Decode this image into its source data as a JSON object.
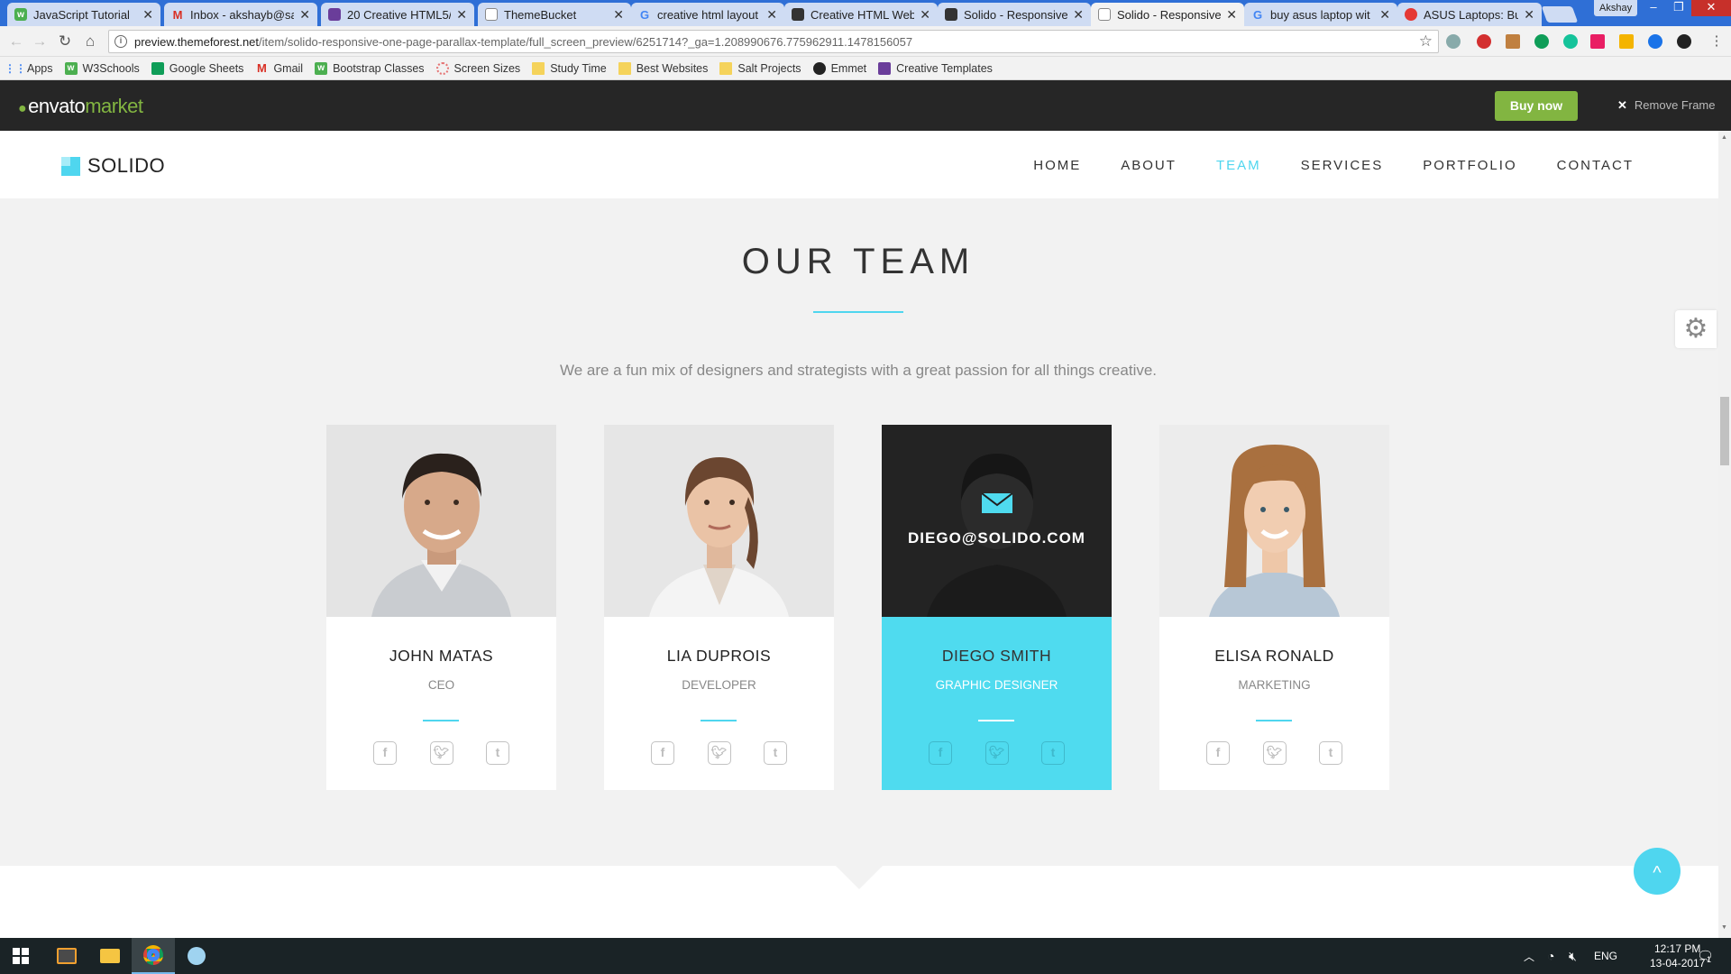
{
  "browser": {
    "tabs": [
      {
        "label": "JavaScript Tutorial",
        "favicon": "w3schools-icon",
        "color": "#4caf50"
      },
      {
        "label": "Inbox - akshayb@sa",
        "favicon": "gmail-icon",
        "color": "#d93025"
      },
      {
        "label": "20 Creative HTML5/",
        "favicon": "site-icon",
        "color": "#6a3d9a"
      },
      {
        "label": "ThemeBucket",
        "favicon": "page-icon",
        "color": "#888888"
      },
      {
        "label": "creative html layout",
        "favicon": "google-icon",
        "color": "#4285f4"
      },
      {
        "label": "Creative HTML Web",
        "favicon": "site-icon",
        "color": "#333333"
      },
      {
        "label": "Solido - Responsive",
        "favicon": "site-icon",
        "color": "#333333"
      },
      {
        "label": "Solido - Responsive",
        "favicon": "page-icon",
        "color": "#888888",
        "active": true
      },
      {
        "label": "buy asus laptop wit",
        "favicon": "google-icon",
        "color": "#4285f4"
      },
      {
        "label": "ASUS Laptops: Buy A",
        "favicon": "site-icon",
        "color": "#e53935"
      }
    ],
    "profile_name": "Akshay",
    "url_host": "preview.themeforest.net",
    "url_path": "/item/solido-responsive-one-page-parallax-template/full_screen_preview/6251714?_ga=1.208990676.775962911.1478156057",
    "bookmarks": [
      {
        "label": "Apps",
        "icon": "apps-grid-icon"
      },
      {
        "label": "W3Schools",
        "icon": "w3schools-icon"
      },
      {
        "label": "Google Sheets",
        "icon": "sheets-icon"
      },
      {
        "label": "Gmail",
        "icon": "gmail-icon"
      },
      {
        "label": "Bootstrap Classes",
        "icon": "w3schools-icon"
      },
      {
        "label": "Screen Sizes",
        "icon": "site-icon"
      },
      {
        "label": "Study Time",
        "icon": "folder-icon"
      },
      {
        "label": "Best Websites",
        "icon": "folder-icon"
      },
      {
        "label": "Salt Projects",
        "icon": "folder-icon"
      },
      {
        "label": "Emmet",
        "icon": "emmet-icon"
      },
      {
        "label": "Creative Templates",
        "icon": "site-icon"
      }
    ]
  },
  "envato": {
    "logo_main": "envato",
    "logo_accent": "market",
    "buy_label": "Buy now",
    "remove_label": "Remove Frame",
    "accent": "#82b541"
  },
  "site": {
    "logo": "SOLIDO",
    "nav": [
      "HOME",
      "ABOUT",
      "TEAM",
      "SERVICES",
      "PORTFOLIO",
      "CONTACT"
    ],
    "active_nav": "TEAM",
    "accent": "#4fd6ef"
  },
  "team": {
    "title": "OUR TEAM",
    "subtitle": "We are a fun mix of designers and strategists with a great passion for all things creative.",
    "members": [
      {
        "name": "JOHN MATAS",
        "role": "CEO"
      },
      {
        "name": "LIA DUPROIS",
        "role": "DEVELOPER"
      },
      {
        "name": "DIEGO SMITH",
        "role": "GRAPHIC DESIGNER",
        "email": "DIEGO@SOLIDO.COM",
        "highlighted": true
      },
      {
        "name": "ELISA RONALD",
        "role": "MARKETING"
      }
    ]
  },
  "taskbar": {
    "language": "ENG",
    "time": "12:17 PM",
    "date": "13-04-2017",
    "notification_count": "1"
  }
}
